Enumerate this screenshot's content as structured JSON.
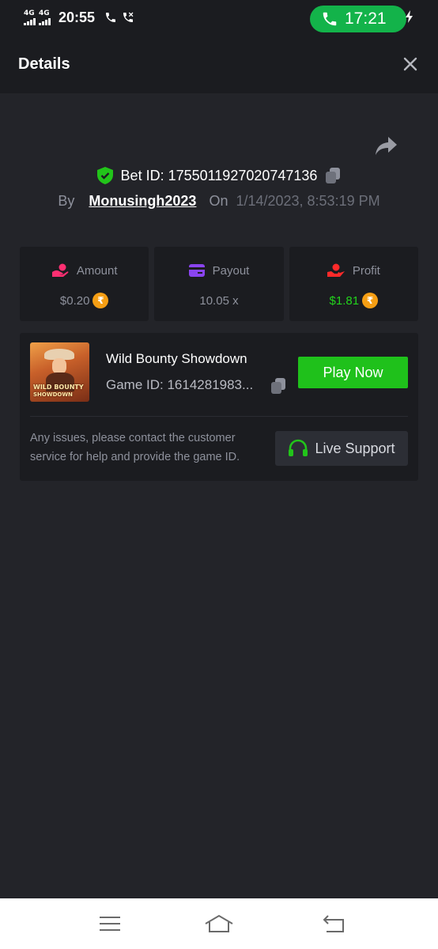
{
  "status_bar": {
    "network_1": "4G",
    "network_2": "4G",
    "time": "20:55",
    "call_timer": "17:21"
  },
  "header": {
    "title": "Details"
  },
  "bet": {
    "bet_id_text": "Bet ID: 1755011927020747136",
    "by_label": "By",
    "username": "Monusingh2023",
    "on_label": "On",
    "datetime": "1/14/2023, 8:53:19 PM"
  },
  "stats": {
    "amount": {
      "label": "Amount",
      "value": "$0.20",
      "currency_symbol": "₹"
    },
    "payout": {
      "label": "Payout",
      "value": "10.05 x"
    },
    "profit": {
      "label": "Profit",
      "value": "$1.81",
      "currency_symbol": "₹"
    }
  },
  "game": {
    "name": "Wild Bounty Showdown",
    "game_id_text": "Game ID: 1614281983...",
    "thumb_title_line1": "WILD BOUNTY",
    "thumb_title_line2": "SHOWDOWN",
    "play_label": "Play Now",
    "issue_text": "Any issues, please contact the customer service for help and provide the game ID.",
    "support_label": "Live Support"
  },
  "colors": {
    "background": "#232429",
    "panel": "#1b1c20",
    "accent_green": "#1fc11b",
    "profit_green": "#22d31c",
    "amount_icon": "#ff2f72",
    "payout_icon": "#8a44f0",
    "profit_icon": "#ff2a2a",
    "coin": "#f59e14"
  },
  "icons": {
    "shield": "shield-check-icon",
    "copy": "copy-icon",
    "share": "share-icon",
    "close": "close-icon",
    "support": "headset-icon"
  }
}
